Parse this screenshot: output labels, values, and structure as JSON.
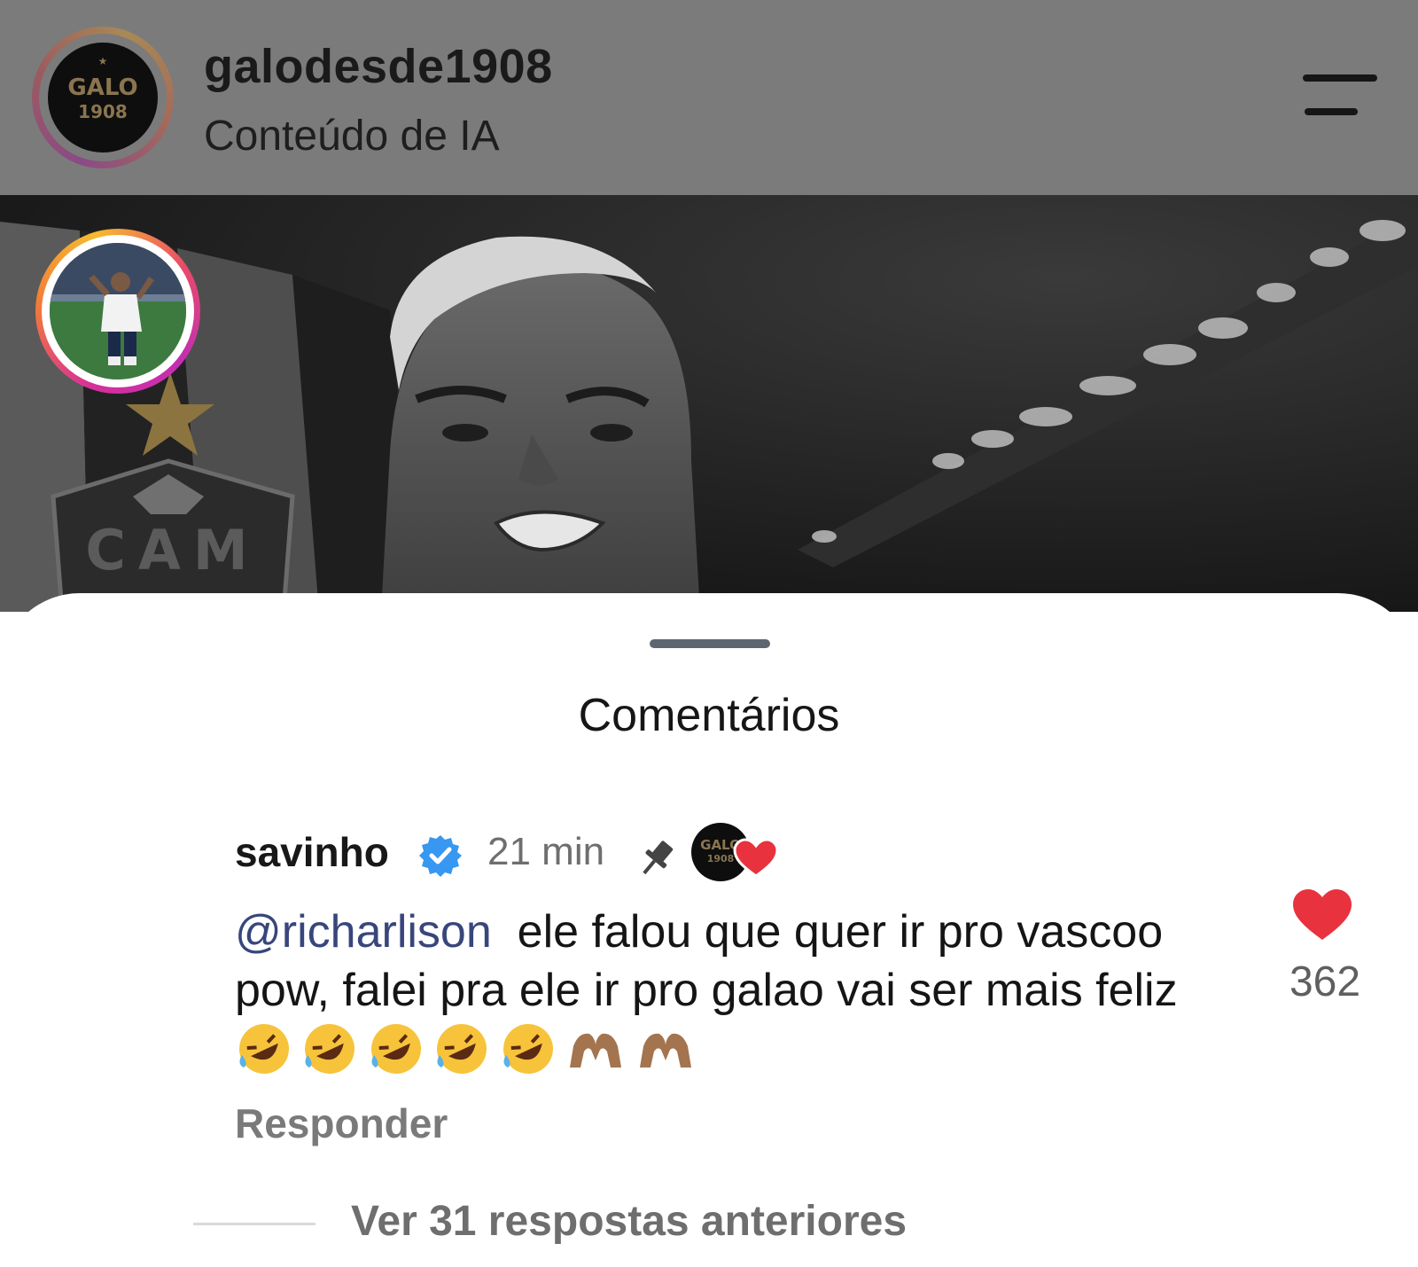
{
  "post_header": {
    "username": "galodesde1908",
    "subtitle": "Conteúdo de IA",
    "avatar_logo": {
      "line1": "GALO",
      "line2": "1908"
    }
  },
  "post_image": {
    "shield_text": "CAM"
  },
  "comments": {
    "title": "Comentários",
    "items": [
      {
        "username": "savinho",
        "verified": true,
        "time": "21 min",
        "pinned": true,
        "liked_by_author": true,
        "author_logo": {
          "line1": "GALO",
          "line2": "1908"
        },
        "mention": "@richarlison",
        "text": "ele falou que quer ir pro vascoo pow, falei pra ele ir pro galao vai ser mais feliz",
        "emojis": [
          "rolling-on-floor-laughing",
          "rolling-on-floor-laughing",
          "rolling-on-floor-laughing",
          "rolling-on-floor-laughing",
          "rolling-on-floor-laughing",
          "heart-hands",
          "heart-hands"
        ],
        "reply_label": "Responder",
        "like_count": "362"
      }
    ],
    "view_more_replies": "Ver 31 respostas anteriores"
  },
  "colors": {
    "header_dim": "#7b7b7b",
    "like_red": "#e8323e",
    "verified_blue": "#3897f0",
    "mention_blue": "#38467c"
  }
}
